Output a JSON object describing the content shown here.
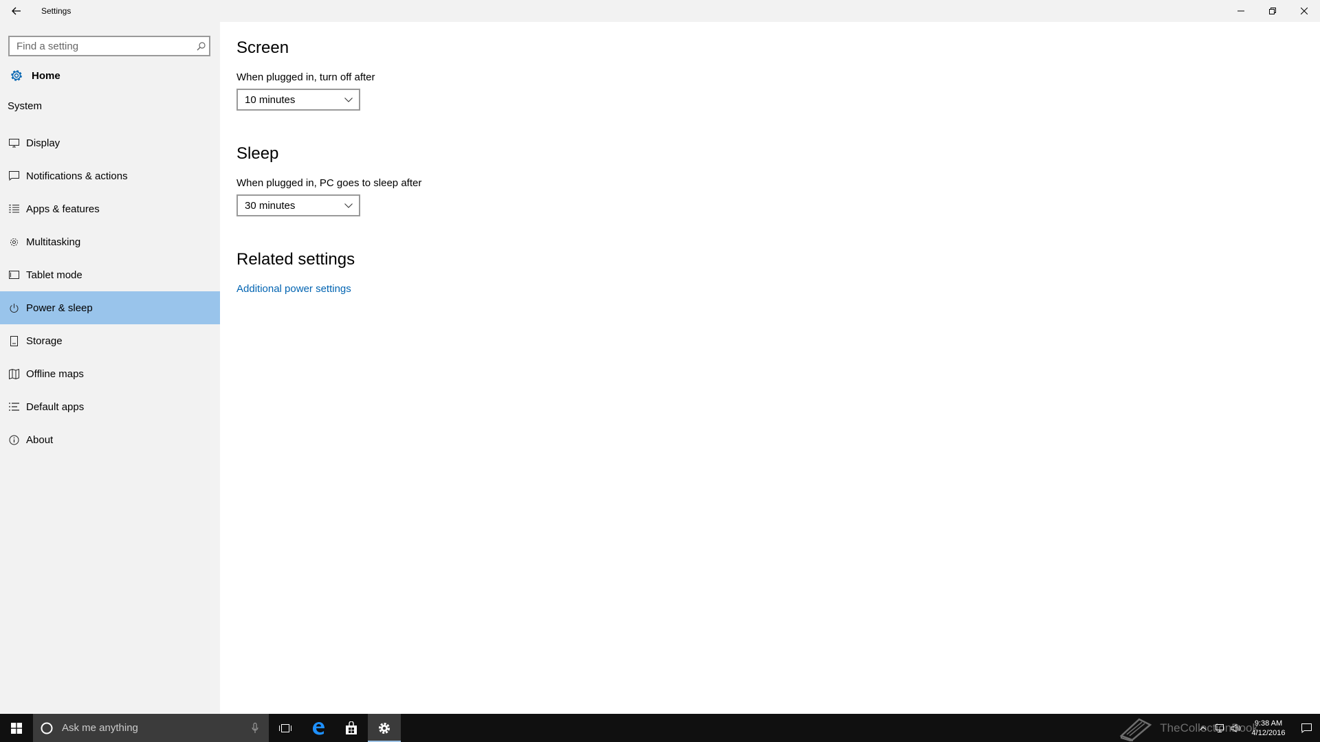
{
  "window": {
    "title": "Settings",
    "controls": {
      "minimize": "—",
      "maximize": "❐",
      "close": "✕"
    }
  },
  "sidebar": {
    "search_placeholder": "Find a setting",
    "home_label": "Home",
    "section_label": "System",
    "items": [
      {
        "label": "Display",
        "icon": "display-icon"
      },
      {
        "label": "Notifications & actions",
        "icon": "notifications-icon"
      },
      {
        "label": "Apps & features",
        "icon": "apps-list-icon"
      },
      {
        "label": "Multitasking",
        "icon": "multitasking-icon"
      },
      {
        "label": "Tablet mode",
        "icon": "tablet-icon"
      },
      {
        "label": "Power & sleep",
        "icon": "power-icon",
        "selected": true
      },
      {
        "label": "Storage",
        "icon": "storage-icon"
      },
      {
        "label": "Offline maps",
        "icon": "map-icon"
      },
      {
        "label": "Default apps",
        "icon": "default-apps-icon"
      },
      {
        "label": "About",
        "icon": "info-icon"
      }
    ]
  },
  "main": {
    "screen": {
      "heading": "Screen",
      "label": "When plugged in, turn off after",
      "value": "10 minutes"
    },
    "sleep": {
      "heading": "Sleep",
      "label": "When plugged in, PC goes to sleep after",
      "value": "30 minutes"
    },
    "related": {
      "heading": "Related settings",
      "link": "Additional power settings"
    }
  },
  "taskbar": {
    "search_placeholder": "Ask me anything",
    "time": "9:38 AM",
    "date": "4/12/2016",
    "watermark": "TheCollectionBook"
  },
  "colors": {
    "accent": "#0063b1",
    "selected_bg": "#99c4eb",
    "sidebar_bg": "#f2f2f2",
    "taskbar_bg": "#101010"
  }
}
